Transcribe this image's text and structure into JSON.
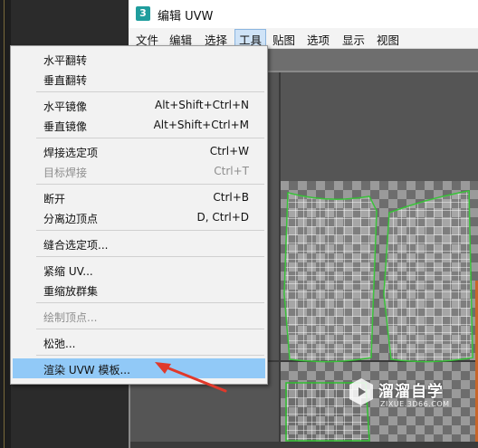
{
  "window": {
    "app_icon": "3",
    "title": "编辑 UVW"
  },
  "menubar": [
    "文件",
    "编辑",
    "选择",
    "工具",
    "贴图",
    "选项",
    "显示",
    "视图"
  ],
  "dropdown": {
    "items": [
      {
        "label": "水平翻转",
        "shortcut": ""
      },
      {
        "label": "垂直翻转",
        "shortcut": ""
      },
      {
        "label": "水平镜像",
        "shortcut": "Alt+Shift+Ctrl+N"
      },
      {
        "label": "垂直镜像",
        "shortcut": "Alt+Shift+Ctrl+M"
      },
      {
        "label": "焊接选定项",
        "shortcut": "Ctrl+W"
      },
      {
        "label": "目标焊接",
        "shortcut": "Ctrl+T"
      },
      {
        "label": "断开",
        "shortcut": "Ctrl+B"
      },
      {
        "label": "分离边顶点",
        "shortcut": "D, Ctrl+D"
      },
      {
        "label": "缝合选定项...",
        "shortcut": ""
      },
      {
        "label": "紧缩 UV...",
        "shortcut": ""
      },
      {
        "label": "重缩放群集",
        "shortcut": ""
      },
      {
        "label": "绘制顶点...",
        "shortcut": ""
      },
      {
        "label": "松弛...",
        "shortcut": ""
      },
      {
        "label": "渲染 UVW 模板...",
        "shortcut": ""
      }
    ]
  },
  "watermark": {
    "title": "溜溜自学",
    "subtitle": "ZIXUE.3D66.COM"
  },
  "colors": {
    "highlight": "#91c9f7",
    "arrow": "#e0392b",
    "uv_border": "#2fbf2f",
    "app_icon": "#1f9d9d"
  }
}
